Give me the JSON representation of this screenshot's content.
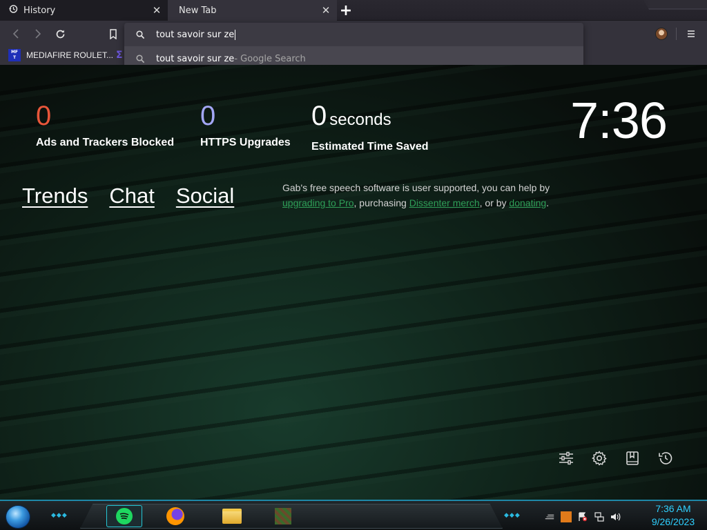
{
  "tabs": [
    {
      "title": "History",
      "close": "✕"
    },
    {
      "title": "New Tab",
      "close": "✕"
    }
  ],
  "new_tab_symbol": "+",
  "omnibox": {
    "value": "tout savoir sur ze",
    "suggestion_query": "tout savoir sur ze",
    "suggestion_suffix": " - Google Search"
  },
  "bookmarks": [
    {
      "label": "MEDIAFIRE ROULET..."
    }
  ],
  "stats": {
    "ads": {
      "value": "0",
      "label": "Ads and Trackers Blocked",
      "color": "#e8563a"
    },
    "https": {
      "value": "0",
      "label": "HTTPS Upgrades",
      "color": "#a3a6f5"
    },
    "time": {
      "value": "0",
      "unit": "seconds",
      "label": "Estimated Time Saved",
      "color": "#ffffff"
    }
  },
  "clock": "7:36",
  "links": {
    "trends": "Trends",
    "chat": "Chat",
    "social": "Social"
  },
  "gab_message": {
    "part1": "Gab's free speech software is user supported, you can help by ",
    "link1": "upgrading to Pro",
    "part2": ", purchasing ",
    "link2": "Dissenter merch",
    "part3": ", or by ",
    "link3": "donating",
    "part4": "."
  },
  "taskbar": {
    "time": "7:36 AM",
    "date": "9/26/2023"
  },
  "icons": {
    "tab_history": "history-icon",
    "back": "back-arrow-icon",
    "forward": "forward-arrow-icon",
    "reload": "reload-icon",
    "bookmark": "bookmark-icon",
    "search": "search-icon",
    "menu": "hamburger-menu-icon",
    "customize": "sliders-icon",
    "settings": "gear-icon",
    "bookmarks_page": "bookmarks-book-icon",
    "history_page": "history-clock-icon"
  },
  "colors": {
    "link_green": "#2f9f58",
    "taskbar_accent": "#2fd0ff"
  }
}
